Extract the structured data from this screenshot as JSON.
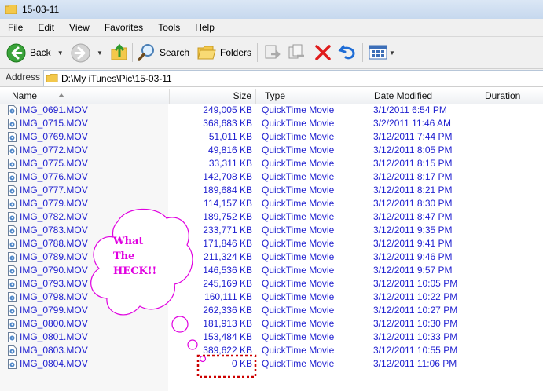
{
  "window": {
    "title": "15-03-11"
  },
  "menu": [
    "File",
    "Edit",
    "View",
    "Favorites",
    "Tools",
    "Help"
  ],
  "toolbar": {
    "back_label": "Back",
    "search_label": "Search",
    "folders_label": "Folders"
  },
  "address": {
    "label": "Address",
    "path": "D:\\My iTunes\\Pic\\15-03-11"
  },
  "columns": {
    "name": "Name",
    "size": "Size",
    "type": "Type",
    "date": "Date Modified",
    "duration": "Duration"
  },
  "files": [
    {
      "name": "IMG_0691.MOV",
      "size": "249,005 KB",
      "type": "QuickTime Movie",
      "date": "3/1/2011 6:54 PM"
    },
    {
      "name": "IMG_0715.MOV",
      "size": "368,683 KB",
      "type": "QuickTime Movie",
      "date": "3/2/2011 11:46 AM"
    },
    {
      "name": "IMG_0769.MOV",
      "size": "51,011 KB",
      "type": "QuickTime Movie",
      "date": "3/12/2011 7:44 PM"
    },
    {
      "name": "IMG_0772.MOV",
      "size": "49,816 KB",
      "type": "QuickTime Movie",
      "date": "3/12/2011 8:05 PM"
    },
    {
      "name": "IMG_0775.MOV",
      "size": "33,311 KB",
      "type": "QuickTime Movie",
      "date": "3/12/2011 8:15 PM"
    },
    {
      "name": "IMG_0776.MOV",
      "size": "142,708 KB",
      "type": "QuickTime Movie",
      "date": "3/12/2011 8:17 PM"
    },
    {
      "name": "IMG_0777.MOV",
      "size": "189,684 KB",
      "type": "QuickTime Movie",
      "date": "3/12/2011 8:21 PM"
    },
    {
      "name": "IMG_0779.MOV",
      "size": "114,157 KB",
      "type": "QuickTime Movie",
      "date": "3/12/2011 8:30 PM"
    },
    {
      "name": "IMG_0782.MOV",
      "size": "189,752 KB",
      "type": "QuickTime Movie",
      "date": "3/12/2011 8:47 PM"
    },
    {
      "name": "IMG_0783.MOV",
      "size": "233,771 KB",
      "type": "QuickTime Movie",
      "date": "3/12/2011 9:35 PM"
    },
    {
      "name": "IMG_0788.MOV",
      "size": "171,846 KB",
      "type": "QuickTime Movie",
      "date": "3/12/2011 9:41 PM"
    },
    {
      "name": "IMG_0789.MOV",
      "size": "211,324 KB",
      "type": "QuickTime Movie",
      "date": "3/12/2011 9:46 PM"
    },
    {
      "name": "IMG_0790.MOV",
      "size": "146,536 KB",
      "type": "QuickTime Movie",
      "date": "3/12/2011 9:57 PM"
    },
    {
      "name": "IMG_0793.MOV",
      "size": "245,169 KB",
      "type": "QuickTime Movie",
      "date": "3/12/2011 10:05 PM"
    },
    {
      "name": "IMG_0798.MOV",
      "size": "160,111 KB",
      "type": "QuickTime Movie",
      "date": "3/12/2011 10:22 PM"
    },
    {
      "name": "IMG_0799.MOV",
      "size": "262,336 KB",
      "type": "QuickTime Movie",
      "date": "3/12/2011 10:27 PM"
    },
    {
      "name": "IMG_0800.MOV",
      "size": "181,913 KB",
      "type": "QuickTime Movie",
      "date": "3/12/2011 10:30 PM"
    },
    {
      "name": "IMG_0801.MOV",
      "size": "153,484 KB",
      "type": "QuickTime Movie",
      "date": "3/12/2011 10:33 PM"
    },
    {
      "name": "IMG_0803.MOV",
      "size": "389,622 KB",
      "type": "QuickTime Movie",
      "date": "3/12/2011 10:55 PM"
    },
    {
      "name": "IMG_0804.MOV",
      "size": "0 KB",
      "type": "QuickTime Movie",
      "date": "3/12/2011 11:06 PM"
    }
  ],
  "annotation": {
    "lines": [
      "What",
      "The",
      "HECK!!"
    ],
    "color": "#e000e0",
    "highlight_color": "#cc0000"
  },
  "colors": {
    "file_text": "#1f1fd0"
  }
}
